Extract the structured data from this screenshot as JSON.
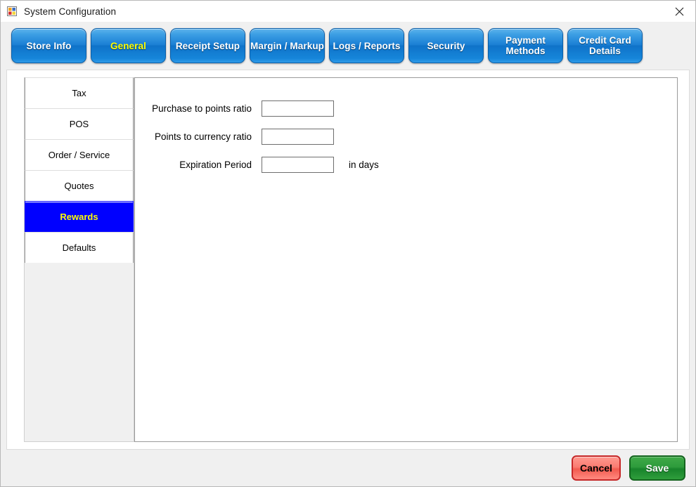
{
  "window": {
    "title": "System Configuration",
    "icon": "form-icon",
    "close_label": "×"
  },
  "tabs": [
    {
      "label": "Store Info",
      "active": false
    },
    {
      "label": "General",
      "active": true
    },
    {
      "label": "Receipt Setup",
      "active": false
    },
    {
      "label": "Margin / Markup",
      "active": false
    },
    {
      "label": "Logs / Reports",
      "active": false
    },
    {
      "label": "Security",
      "active": false
    },
    {
      "label": "Payment Methods",
      "active": false
    },
    {
      "label": "Credit Card Details",
      "active": false
    }
  ],
  "sidebar": {
    "items": [
      {
        "label": "Tax",
        "selected": false
      },
      {
        "label": "POS",
        "selected": false
      },
      {
        "label": "Order / Service",
        "selected": false
      },
      {
        "label": "Quotes",
        "selected": false
      },
      {
        "label": "Rewards",
        "selected": true
      },
      {
        "label": "Defaults",
        "selected": false
      }
    ]
  },
  "form": {
    "fields": [
      {
        "label": "Purchase to points ratio",
        "value": "",
        "suffix": ""
      },
      {
        "label": "Points to currency ratio",
        "value": "",
        "suffix": ""
      },
      {
        "label": "Expiration Period",
        "value": "",
        "suffix": "in days"
      }
    ]
  },
  "footer": {
    "cancel_label": "Cancel",
    "save_label": "Save"
  },
  "colors": {
    "tab_blue": "#1a7fd4",
    "active_tab_text": "#ffff00",
    "selected_item_bg": "#0000ff",
    "selected_item_text": "#ffff00",
    "cancel_red": "#f25b50",
    "save_green": "#18842b",
    "panel_gray": "#f0f0f0"
  }
}
